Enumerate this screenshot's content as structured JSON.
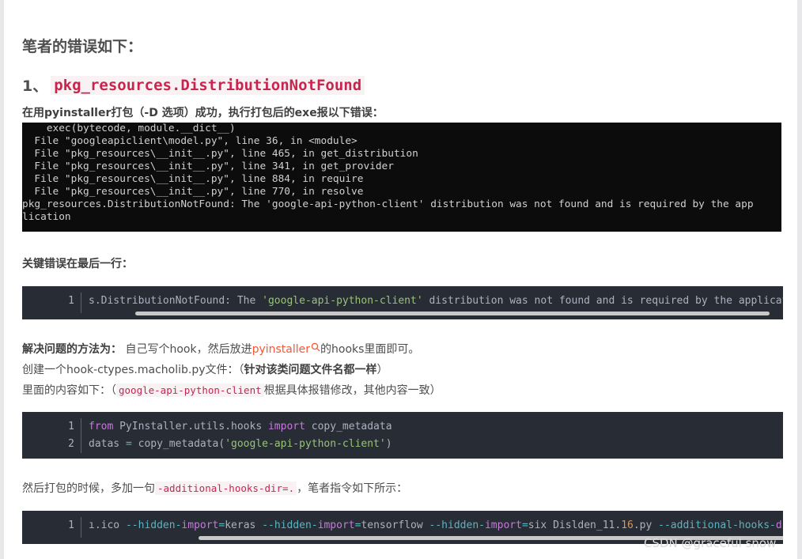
{
  "heading": "笔者的错误如下：",
  "section1": {
    "number": "1、",
    "code": "pkg_resources.DistributionNotFound"
  },
  "intro": "在用pyinstaller打包（-D 选项）成功，执行打包后的exe报以下错误：",
  "terminal": {
    "lines": [
      "    exec(bytecode, module.__dict__)",
      "  File \"googleapiclient\\model.py\", line 36, in <module>",
      "  File \"pkg_resources\\__init__.py\", line 465, in get_distribution",
      "  File \"pkg_resources\\__init__.py\", line 341, in get_provider",
      "  File \"pkg_resources\\__init__.py\", line 884, in require",
      "  File \"pkg_resources\\__init__.py\", line 770, in resolve",
      "pkg_resources.DistributionNotFound: The 'google-api-python-client' distribution was not found and is required by the app",
      "lication"
    ]
  },
  "key_error_label": "关键错误在最后一行：",
  "code1": {
    "line_number": "1",
    "before": "s.DistributionNotFound: The ",
    "string": "'google-api-python-client'",
    "after": " distribution was not found and is required by the application"
  },
  "solution": {
    "label": "解决问题的方法为：",
    "text1": "自己写个hook，然后放进",
    "link": "pyinstaller",
    "text2": "的hooks里面即可。",
    "create_text": "创建一个hook-ctypes.macholib.py文件：",
    "create_paren_open": "（",
    "create_bold": "针对该类问题文件名都一样",
    "create_paren_close": "）",
    "content_text": "里面的内容如下：（",
    "content_code": "google-api-python-client",
    "content_rest": "根据具体报错修改，其他内容一致）"
  },
  "code2": {
    "lines": [
      {
        "n": "1",
        "kw1": "from",
        "mod": " PyInstaller.utils.hooks ",
        "kw2": "import",
        "rest": " copy_metadata"
      },
      {
        "n": "2",
        "var": "datas ",
        "eq": "=",
        "call": " copy_metadata(",
        "str": "'google-api-python-client'",
        "close": ")"
      }
    ]
  },
  "then_text": "然后打包的时候，多加一句",
  "then_code": "-additional-hooks-dir=.",
  "then_rest": "，笔者指令如下所示：",
  "code3": {
    "line_number": "1",
    "parts": [
      {
        "t": "ı.ico ",
        "c": ""
      },
      {
        "t": "--hidden-",
        "c": "op"
      },
      {
        "t": "import",
        "c": "kw"
      },
      {
        "t": "=",
        "c": "op"
      },
      {
        "t": "keras ",
        "c": ""
      },
      {
        "t": "--hidden-",
        "c": "op"
      },
      {
        "t": "import",
        "c": "kw"
      },
      {
        "t": "=",
        "c": "op"
      },
      {
        "t": "tensorflow ",
        "c": ""
      },
      {
        "t": "--hidden-",
        "c": "op"
      },
      {
        "t": "import",
        "c": "kw"
      },
      {
        "t": "=",
        "c": "op"
      },
      {
        "t": "six Dislden_11.",
        "c": ""
      },
      {
        "t": "16",
        "c": "nm"
      },
      {
        "t": ".py ",
        "c": ""
      },
      {
        "t": "--additional-hooks-",
        "c": "op"
      },
      {
        "t": "dir",
        "c": "kw"
      },
      {
        "t": "=.",
        "c": "op"
      }
    ]
  },
  "watermark": "CSDN @graceful snow"
}
